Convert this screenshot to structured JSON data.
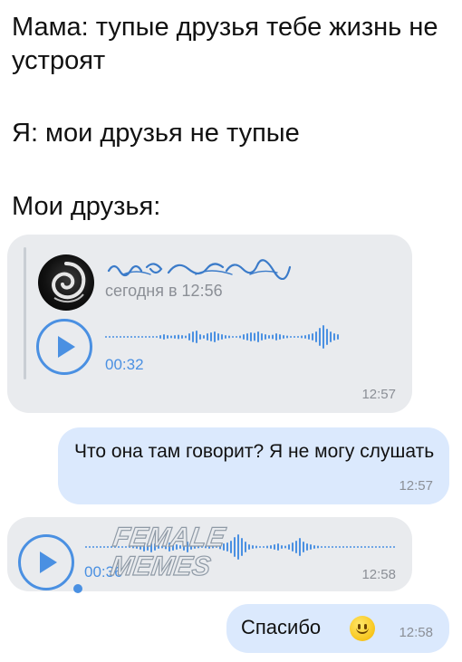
{
  "captions": {
    "line1": "Мама: тупые друзья тебе жизнь не устроят",
    "line2": "Я: мои друзья не тупые",
    "line3": "Мои друзья:"
  },
  "chat": {
    "forwarded_voice": {
      "forwarded_time": "сегодня в 12:56",
      "duration": "00:32",
      "time": "12:57"
    },
    "question": {
      "text": "Что она там говорит? Я не могу слушать",
      "time": "12:57"
    },
    "voice_reply": {
      "duration": "00:36",
      "time": "12:58"
    },
    "thanks": {
      "text": "Спасибо",
      "time": "12:58"
    }
  },
  "watermark": {
    "line1": "FEMALE",
    "line2": "MEMES"
  },
  "colors": {
    "accent": "#4a90e2",
    "incoming_bubble": "#e9ebee",
    "outgoing_bubble": "#dbe9fd",
    "meta_text": "#8b8f96"
  },
  "icons": {
    "play": "play-icon",
    "smile": "smiling-face-emoji"
  }
}
